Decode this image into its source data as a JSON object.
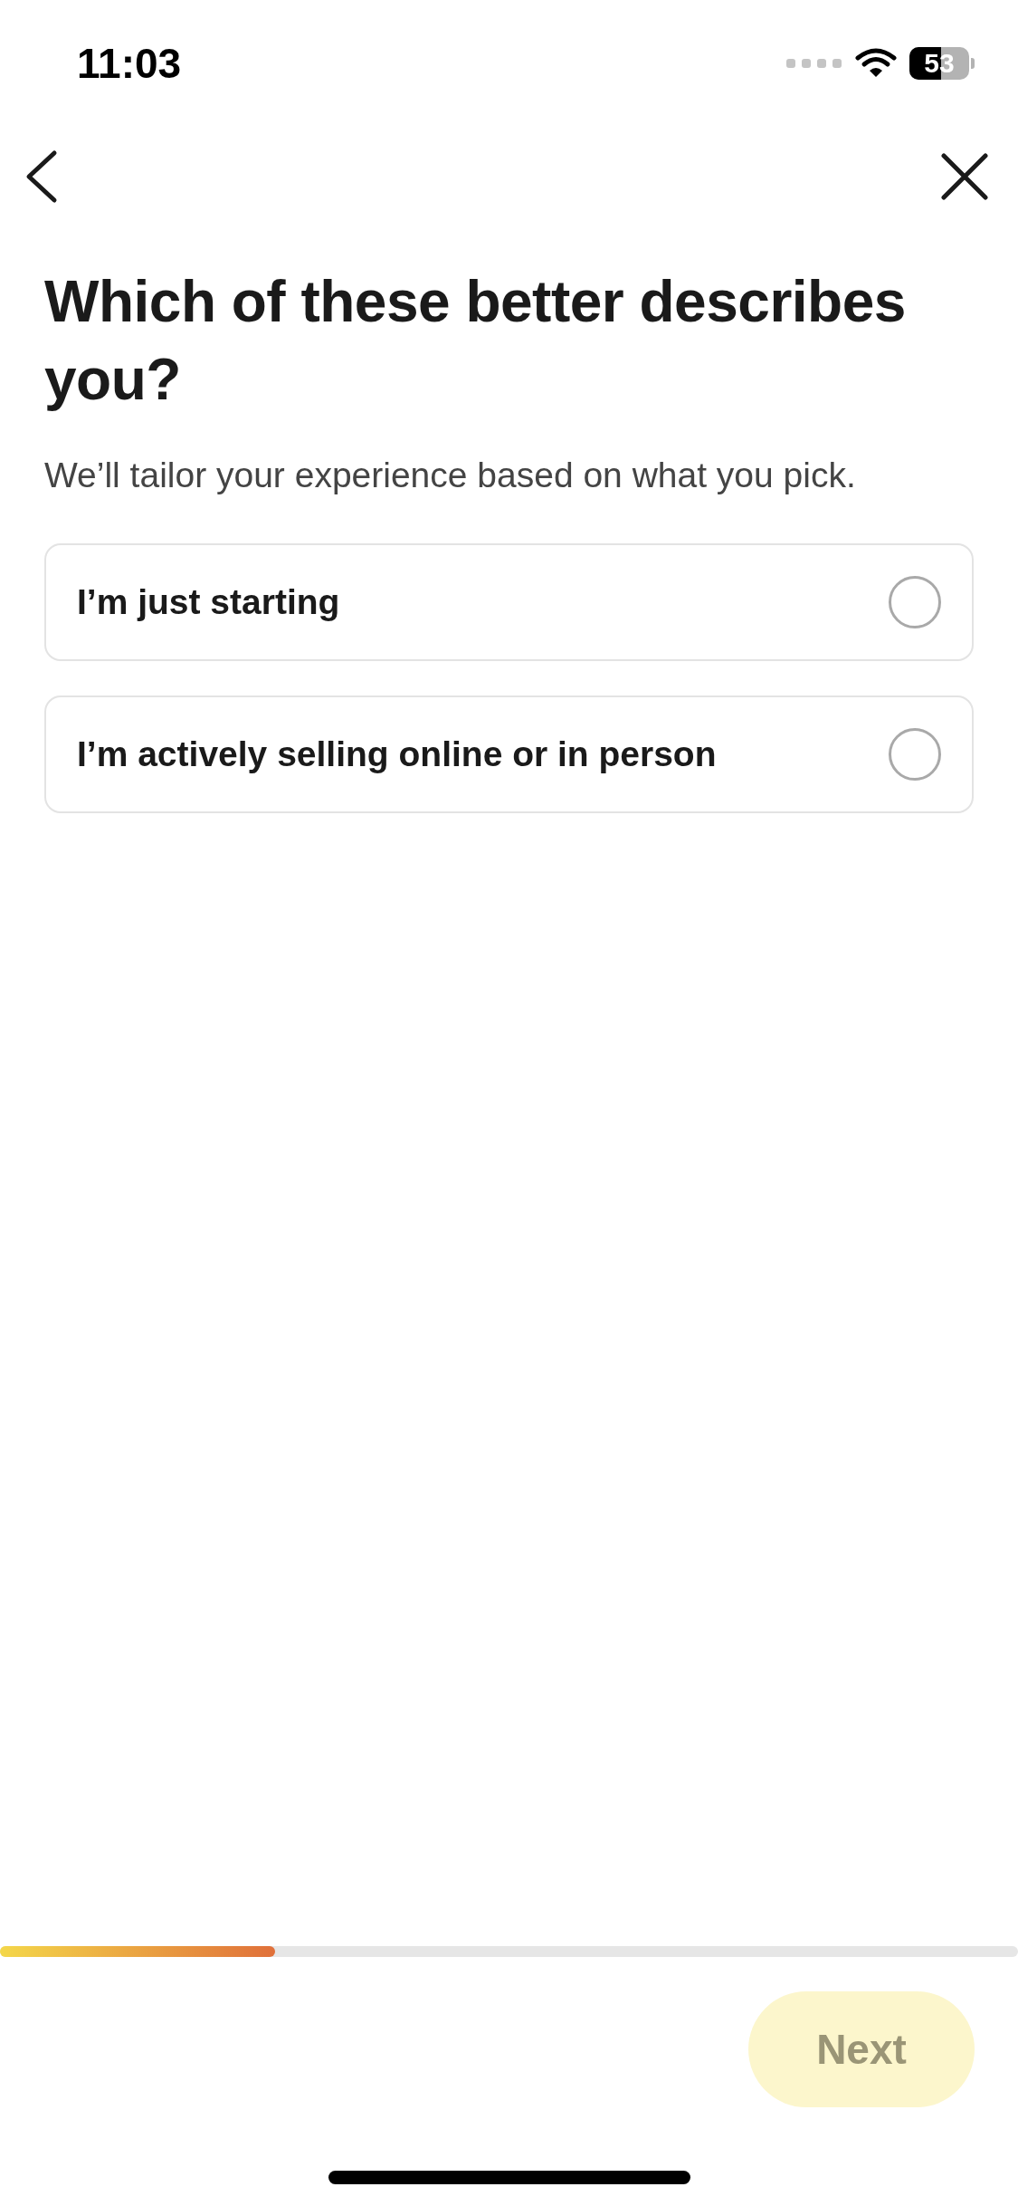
{
  "status_bar": {
    "time": "11:03",
    "battery": "53"
  },
  "title": "Which of these better describes you?",
  "subtitle": "We’ll tailor your experience based on what you pick.",
  "options": [
    {
      "label": "I’m just starting",
      "selected": false
    },
    {
      "label": "I’m actively selling online or in person",
      "selected": false
    }
  ],
  "progress": {
    "level": 0.27
  },
  "next_button": {
    "label": "Next",
    "disabled": true
  }
}
